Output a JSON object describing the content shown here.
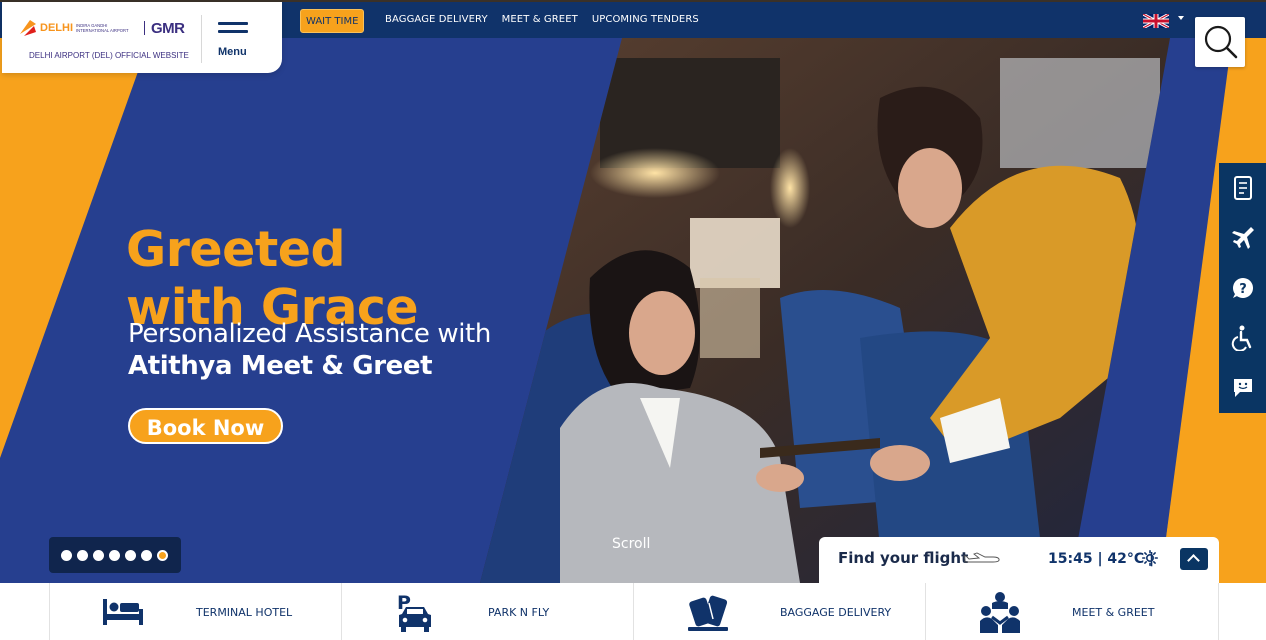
{
  "header": {
    "logo": {
      "city": "DELHI",
      "airport_name": "INDIRA GANDHI INTERNATIONAL AIRPORT",
      "brand": "GMR",
      "subtitle": "DELHI AIRPORT (DEL) OFFICIAL WEBSITE"
    },
    "menu_label": "Menu",
    "wait_time_label": "WAIT TIME",
    "nav_links": [
      "BAGGAGE DELIVERY",
      "MEET & GREET",
      "UPCOMING TENDERS"
    ],
    "language_icon": "uk-flag-icon",
    "search_icon": "search-icon"
  },
  "hero": {
    "headline_line1": "Greeted",
    "headline_line2": "with Grace",
    "subline1": "Personalized Assistance with",
    "subline2": "Atithya Meet & Greet",
    "cta_label": "Book Now",
    "slide_count": 7,
    "active_slide": 7,
    "scroll_label": "Scroll",
    "colors": {
      "accent": "#f7a21c",
      "blue": "#263f8f",
      "navy": "#10336a"
    }
  },
  "side_rail": {
    "items": [
      {
        "icon": "boarding-pass-icon"
      },
      {
        "icon": "airplane-icon"
      },
      {
        "icon": "help-icon"
      },
      {
        "icon": "accessibility-icon"
      },
      {
        "icon": "chat-icon"
      }
    ]
  },
  "find_flight": {
    "label": "Find your flight",
    "time_weather": "15:45 | 42°C |",
    "weather_icon": "sun-icon",
    "toggle_icon": "chevron-up-icon"
  },
  "services": [
    {
      "label": "TERMINAL HOTEL",
      "icon": "bed-icon"
    },
    {
      "label": "PARK N FLY",
      "icon": "parking-car-icon"
    },
    {
      "label": "BAGGAGE DELIVERY",
      "icon": "luggage-icon"
    },
    {
      "label": "MEET & GREET",
      "icon": "people-meet-icon"
    }
  ]
}
